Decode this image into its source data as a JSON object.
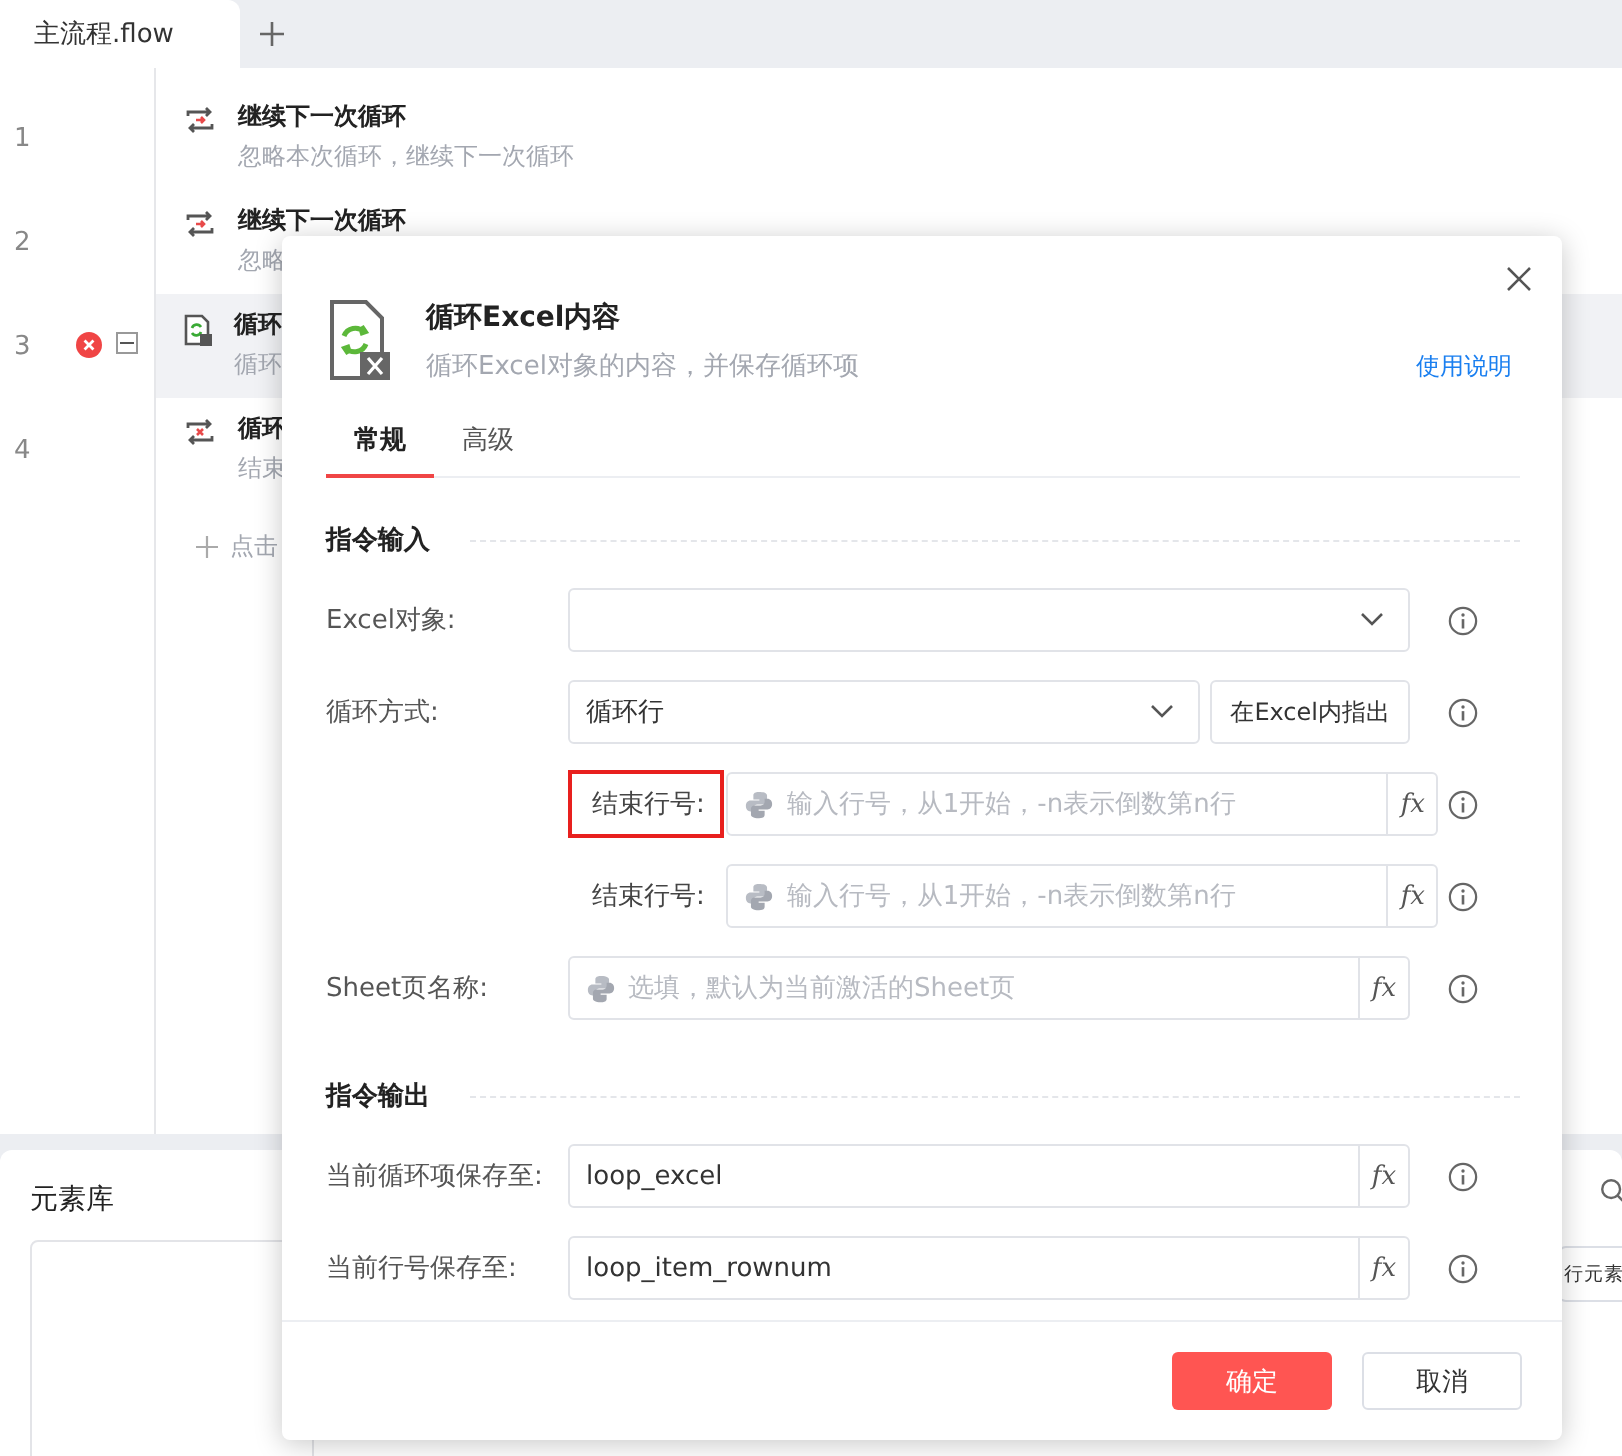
{
  "tab_bar": {
    "tabs": [
      {
        "label": "主流程.flow",
        "selected": true
      }
    ]
  },
  "flow": {
    "rows": [
      {
        "line": "1",
        "kind": "continue",
        "title": "继续下一次循环",
        "description": "忽略本次循环，继续下一次循环",
        "selected": false,
        "error": false
      },
      {
        "line": "2",
        "kind": "continue",
        "title": "继续下一次循环",
        "description": "忽略",
        "selected": false,
        "error": false
      },
      {
        "line": "3",
        "kind": "excel-loop",
        "title": "循环",
        "description": "循环",
        "selected": true,
        "error": true,
        "expanded": true
      },
      {
        "line": "4",
        "kind": "break",
        "title": "循环",
        "description": "结束",
        "selected": false,
        "error": false
      }
    ],
    "add_step": "点击"
  },
  "element_panel": {
    "title": "元素库",
    "button": "行元素"
  },
  "dialog": {
    "title": "循环Excel内容",
    "description": "循环Excel对象的内容，并保存循环项",
    "help_link": "使用说明",
    "tabs": [
      {
        "label": "常规",
        "selected": true
      },
      {
        "label": "高级",
        "selected": false
      }
    ],
    "sections": [
      {
        "title": "指令输入",
        "fields": [
          {
            "kind": "select",
            "label": "Excel对象:"
          },
          {
            "kind": "select",
            "label": "循环方式:",
            "value": "循环行",
            "button": "在Excel内指出"
          },
          {
            "kind": "sub-expression",
            "label": "结束行号:",
            "placeholder": "输入行号，从1开始，-n表示倒数第n行",
            "function_button": "fx",
            "highlighted": true
          },
          {
            "kind": "sub-expression",
            "label": "结束行号:",
            "placeholder": "输入行号，从1开始，-n表示倒数第n行",
            "function_button": "fx",
            "highlighted": false
          },
          {
            "kind": "expression",
            "label": "Sheet页名称:",
            "placeholder": "选填，默认为当前激活的Sheet页",
            "function_button": "fx",
            "highlighted": false
          }
        ]
      },
      {
        "title": "指令输出",
        "fields": [
          {
            "kind": "variable",
            "label": "当前循环项保存至:",
            "value": "loop_excel",
            "function_button": "fx"
          },
          {
            "kind": "variable",
            "label": "当前行号保存至:",
            "value": "loop_item_rownum",
            "function_button": "fx"
          }
        ]
      }
    ],
    "buttons": [
      {
        "label": "确定",
        "kind": "primary"
      },
      {
        "label": "取消",
        "kind": "secondary"
      }
    ]
  }
}
